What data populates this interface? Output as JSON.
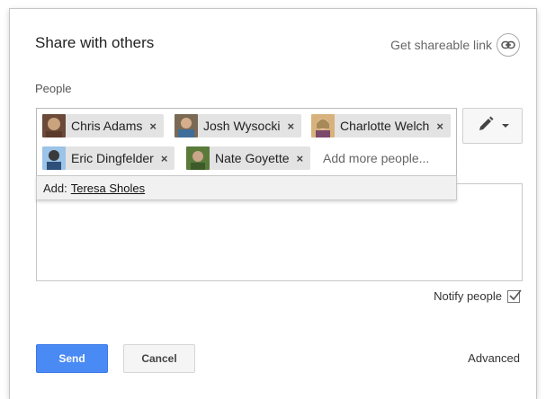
{
  "dialog": {
    "title": "Share with others",
    "get_link_label": "Get shareable link",
    "people_label": "People"
  },
  "chips": [
    {
      "name": "Chris Adams",
      "remove": "×",
      "avatar_icon": "person-photo-icon",
      "avatar_colors": [
        "#6b4a3a",
        "#c9a27e"
      ]
    },
    {
      "name": "Josh Wysocki",
      "remove": "×",
      "avatar_icon": "person-photo-icon",
      "avatar_colors": [
        "#7a6a55",
        "#3f6d9a"
      ]
    },
    {
      "name": "Charlotte Welch",
      "remove": "×",
      "avatar_icon": "person-photo-icon",
      "avatar_colors": [
        "#a88a5a",
        "#d8b27c"
      ]
    },
    {
      "name": "Eric Dingfelder",
      "remove": "×",
      "avatar_icon": "person-photo-icon",
      "avatar_colors": [
        "#3a3a3a",
        "#9cc3e8"
      ]
    },
    {
      "name": "Nate Goyette",
      "remove": "×",
      "avatar_icon": "person-photo-icon",
      "avatar_colors": [
        "#5a7a3a",
        "#c9a58a"
      ]
    }
  ],
  "input": {
    "placeholder": "Add more people..."
  },
  "suggestion": {
    "prefix": "Add:",
    "name": "Teresa Sholes"
  },
  "permission": {
    "icon": "pencil-icon"
  },
  "notify": {
    "label": "Notify people",
    "checked": true
  },
  "buttons": {
    "send": "Send",
    "cancel": "Cancel",
    "advanced": "Advanced"
  },
  "colors": {
    "primary": "#4a8af4",
    "chip_bg": "#e3e3e3"
  }
}
